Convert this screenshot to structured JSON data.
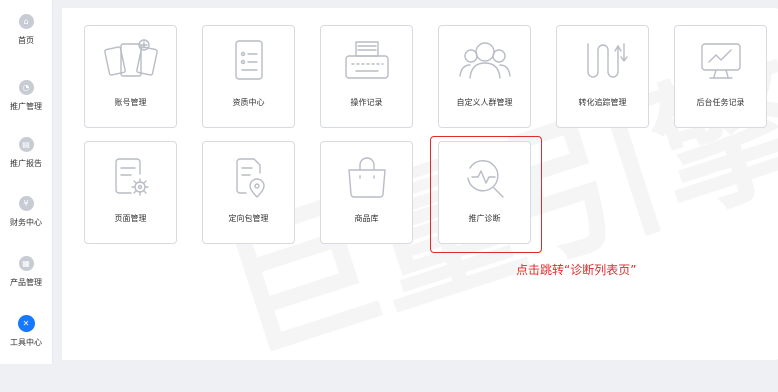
{
  "sidebar": {
    "items": [
      {
        "label": "首页",
        "icon": "home-icon"
      },
      {
        "label": "推广管理",
        "icon": "promotion-icon"
      },
      {
        "label": "推广报告",
        "icon": "report-icon"
      },
      {
        "label": "财务中心",
        "icon": "yen-icon"
      },
      {
        "label": "产品管理",
        "icon": "product-icon"
      },
      {
        "label": "工具中心",
        "icon": "tools-icon",
        "active": true
      }
    ]
  },
  "tools": [
    {
      "label": "账号管理",
      "icon": "cards-icon"
    },
    {
      "label": "资质中心",
      "icon": "checklist-icon"
    },
    {
      "label": "操作记录",
      "icon": "typewriter-icon"
    },
    {
      "label": "自定义人群管理",
      "icon": "people-icon"
    },
    {
      "label": "转化追踪管理",
      "icon": "tracking-icon"
    },
    {
      "label": "后台任务记录",
      "icon": "monitor-icon"
    },
    {
      "label": "页面管理",
      "icon": "page-gear-icon"
    },
    {
      "label": "定向包管理",
      "icon": "location-doc-icon"
    },
    {
      "label": "商品库",
      "icon": "bag-icon"
    },
    {
      "label": "推广诊断",
      "icon": "diagnosis-icon"
    }
  ],
  "annotation": {
    "text": "点击跳转“诊断列表页”",
    "color": "#e02b2b"
  },
  "watermark": "巨量引擎",
  "colors": {
    "accent": "#1677ff",
    "highlight": "#e02b2b",
    "icon_gray": "#b8bcc6"
  }
}
